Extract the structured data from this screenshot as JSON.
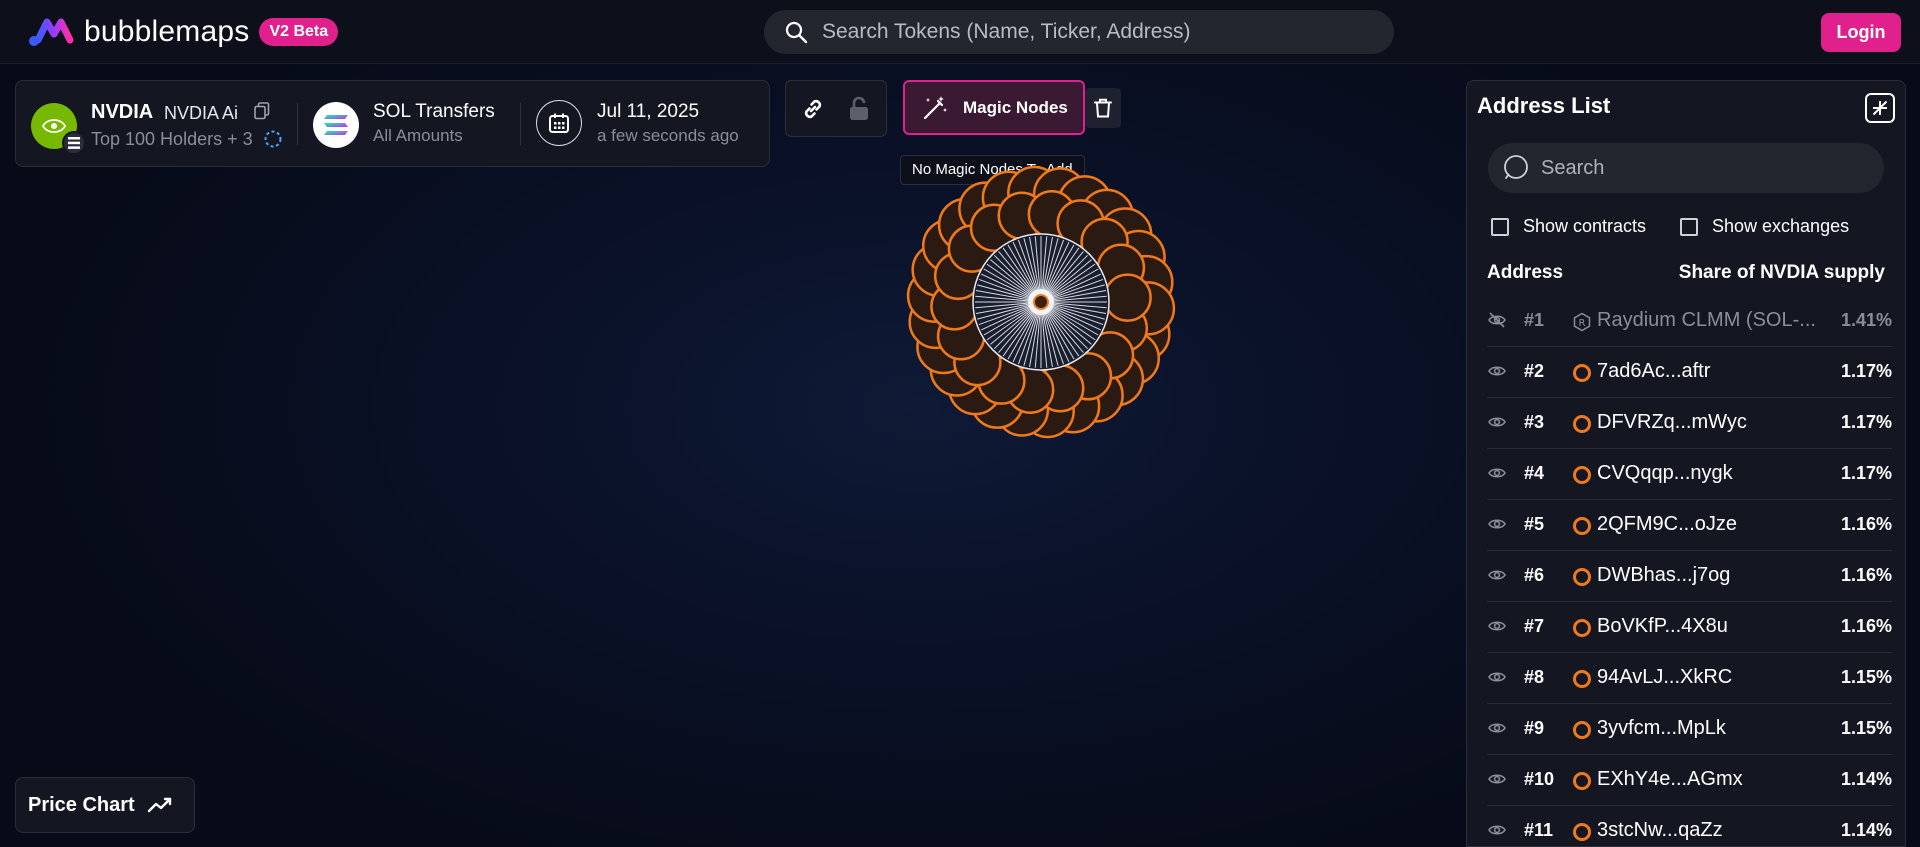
{
  "app": {
    "brand": "bubblemaps",
    "badge": "V2 Beta",
    "search_placeholder": "Search Tokens (Name, Ticker, Address)",
    "login_label": "Login"
  },
  "token": {
    "symbol": "NVDIA",
    "name": "NVDIA Ai",
    "avatar_text": "NVIDIA",
    "holders_label": "Top 100 Holders + 3"
  },
  "transfers": {
    "title": "SOL Transfers",
    "subtitle": "All Amounts"
  },
  "date": {
    "title": "Jul 11, 2025",
    "subtitle": "a few seconds ago"
  },
  "toolbar": {
    "magic_label": "Magic Nodes",
    "tooltip": "No Magic Nodes To Add"
  },
  "address_list": {
    "title": "Address List",
    "search_placeholder": "Search",
    "show_contracts": "Show contracts",
    "show_exchanges": "Show exchanges",
    "col_address": "Address",
    "col_share": "Share of NVDIA supply",
    "rows": [
      {
        "rank": "#1",
        "address": "Raydium CLMM (SOL-...",
        "share": "1.41%",
        "hidden": true
      },
      {
        "rank": "#2",
        "address": "7ad6Ac...aftr",
        "share": "1.17%"
      },
      {
        "rank": "#3",
        "address": "DFVRZq...mWyc",
        "share": "1.17%"
      },
      {
        "rank": "#4",
        "address": "CVQqqp...nygk",
        "share": "1.17%"
      },
      {
        "rank": "#5",
        "address": "2QFM9C...oJze",
        "share": "1.16%"
      },
      {
        "rank": "#6",
        "address": "DWBhas...j7og",
        "share": "1.16%"
      },
      {
        "rank": "#7",
        "address": "BoVKfP...4X8u",
        "share": "1.16%"
      },
      {
        "rank": "#8",
        "address": "94AvLJ...XkRC",
        "share": "1.15%"
      },
      {
        "rank": "#9",
        "address": "3yvfcm...MpLk",
        "share": "1.15%"
      },
      {
        "rank": "#10",
        "address": "EXhY4e...AGmx",
        "share": "1.14%"
      },
      {
        "rank": "#11",
        "address": "3stcNw...qaZz",
        "share": "1.14%"
      }
    ]
  },
  "price_chart_label": "Price Chart",
  "colors": {
    "accent": "#e0208c",
    "bubble": "#f07a1a",
    "panel": "#141722",
    "nvidia_green": "#76b900"
  }
}
